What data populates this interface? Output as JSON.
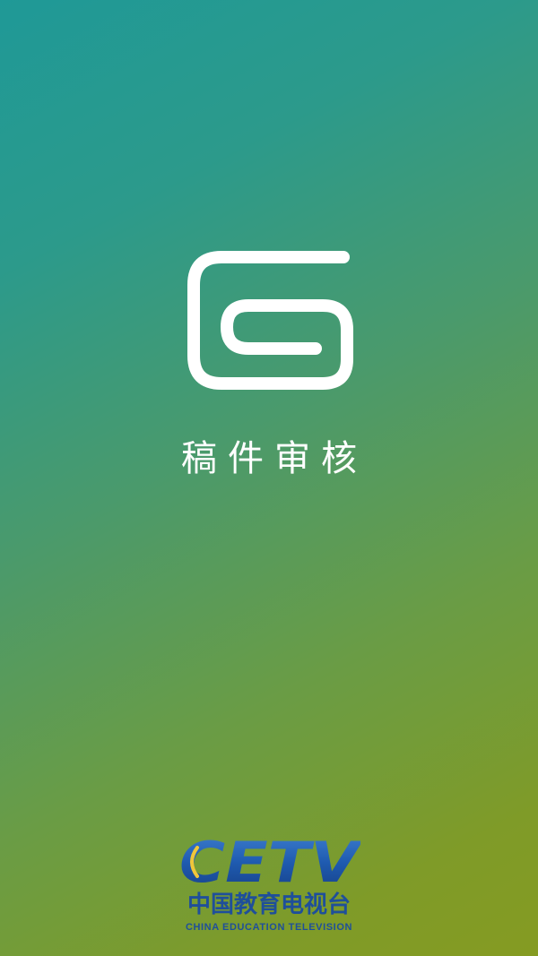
{
  "app": {
    "title": "稿件审核",
    "logo_icon": "paper-clip-g-icon"
  },
  "colors": {
    "gradient_start": "#1f9997",
    "gradient_end": "#859b22",
    "logo_color": "#ffffff",
    "brand_blue": "#1f4f9a"
  },
  "brand": {
    "logo_icon": "cetv-logo-icon",
    "wordmark": "CETV",
    "name_cn": "中国教育电视台",
    "name_en": "CHINA EDUCATION TELEVISION"
  }
}
